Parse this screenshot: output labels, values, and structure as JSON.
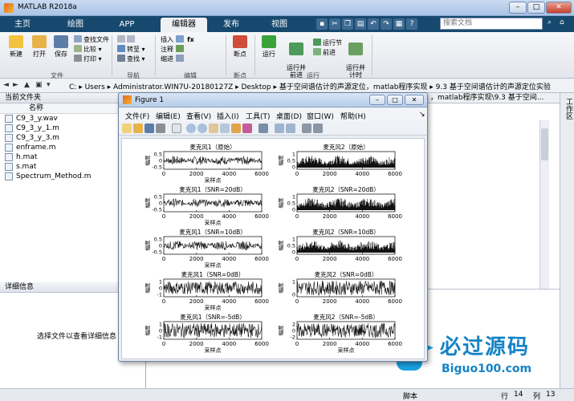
{
  "window": {
    "title": "MATLAB R2018a",
    "min": "–",
    "max": "□",
    "close": "✕"
  },
  "tabs": [
    {
      "label": "主页"
    },
    {
      "label": "绘图"
    },
    {
      "label": "APP"
    },
    {
      "label": "编辑器"
    },
    {
      "label": "发布"
    },
    {
      "label": "视图"
    }
  ],
  "search": {
    "placeholder": "搜索文档"
  },
  "ribbon": {
    "file_group": {
      "label": "文件",
      "new": "新建",
      "open": "打开",
      "save": "保存",
      "find_files": "查找文件",
      "compare": "比较",
      "print": "打印"
    },
    "nav_group": {
      "label": "导航",
      "goto": "转至",
      "find": "查找"
    },
    "edit_group": {
      "label": "编辑",
      "insert": "插入",
      "comment": "注释",
      "indent": "缩进",
      "fx": "fx"
    },
    "bp_group": {
      "label": "断点",
      "breakpoints": "断点"
    },
    "run_group": {
      "label": "运行",
      "run": "运行",
      "run_advance": "运行并\n前进",
      "run_section": "运行节",
      "advance": "前进",
      "run_time": "运行并\n计时"
    }
  },
  "address": {
    "path": [
      "C:",
      "Users",
      "Administrator.WIN7U-20180127Z",
      "Desktop",
      "基于空间谱估计的声源定位，matlab程序实现",
      "9.3 基于空间谱估计的声源定位实验"
    ]
  },
  "left": {
    "current_folder": "当前文件夹",
    "col_name": "名称",
    "files": [
      "C9_3_y.wav",
      "C9_3_y_1.m",
      "C9_3_y_3.m",
      "enframe.m",
      "h.mat",
      "s.mat",
      "Spectrum_Method.m"
    ],
    "details_title": "详细信息",
    "details_msg": "选择文件以查看详细信息"
  },
  "editor_tab": "，matlab程序实现\\9.3 基于空间...",
  "status": {
    "script": "脚本",
    "row_label": "行",
    "row": "14",
    "col_label": "列",
    "col": "13"
  },
  "right_tab": "工作区",
  "watermark": {
    "cn": "必过源码",
    "en": "Biguo100.com"
  },
  "figure": {
    "title": "Figure 1",
    "menu": [
      "文件(F)",
      "编辑(E)",
      "查看(V)",
      "插入(I)",
      "工具(T)",
      "桌面(D)",
      "窗口(W)",
      "帮助(H)"
    ],
    "colors": {
      "line": "#111111",
      "axis": "#000000"
    }
  },
  "chart_data": [
    {
      "type": "line",
      "title": "麦克风1（原始）",
      "xlabel": "采样点",
      "ylabel": "幅度",
      "xlim": [
        0,
        6000
      ],
      "xticks": [
        0,
        2000,
        4000,
        6000
      ],
      "yticks": [
        0.5,
        0,
        -0.5
      ],
      "amp": 0.55,
      "envelope": "bursty"
    },
    {
      "type": "line",
      "title": "麦克风2（原始）",
      "xlabel": "",
      "ylabel": "幅度",
      "xlim": [
        0,
        6000
      ],
      "xticks": [
        0,
        2000,
        4000,
        6000
      ],
      "yticks": [
        1,
        0.5,
        0
      ],
      "amp": 0.9,
      "envelope": "positive"
    },
    {
      "type": "line",
      "title": "麦克风1（SNR=20dB）",
      "xlabel": "采样点",
      "ylabel": "幅度",
      "xlim": [
        0,
        6000
      ],
      "xticks": [
        0,
        2000,
        4000,
        6000
      ],
      "yticks": [
        0.5,
        0,
        -0.5
      ],
      "amp": 0.55,
      "envelope": "bursty"
    },
    {
      "type": "line",
      "title": "麦克风2（SNR=20dB）",
      "xlabel": "",
      "ylabel": "幅度",
      "xlim": [
        0,
        6000
      ],
      "xticks": [
        0,
        2000,
        4000,
        6000
      ],
      "yticks": [
        1,
        0.5,
        0
      ],
      "amp": 0.9,
      "envelope": "positive"
    },
    {
      "type": "line",
      "title": "麦克风1（SNR=10dB）",
      "xlabel": "采样点",
      "ylabel": "幅度",
      "xlim": [
        0,
        6000
      ],
      "xticks": [
        0,
        2000,
        4000,
        6000
      ],
      "yticks": [
        0.5,
        0,
        -0.5
      ],
      "amp": 0.6,
      "envelope": "bursty"
    },
    {
      "type": "line",
      "title": "麦克风2（SNR=10dB）",
      "xlabel": "",
      "ylabel": "幅度",
      "xlim": [
        0,
        6000
      ],
      "xticks": [
        0,
        2000,
        4000,
        6000
      ],
      "yticks": [
        1,
        0.5,
        0
      ],
      "amp": 0.9,
      "envelope": "positive"
    },
    {
      "type": "line",
      "title": "麦克风1（SNR=0dB）",
      "xlabel": "采样点",
      "ylabel": "幅度",
      "xlim": [
        0,
        6000
      ],
      "xticks": [
        0,
        2000,
        4000,
        6000
      ],
      "yticks": [
        1,
        0,
        -1
      ],
      "amp": 0.8,
      "envelope": "noise"
    },
    {
      "type": "line",
      "title": "麦克风2（SNR=0dB）",
      "xlabel": "",
      "ylabel": "幅度",
      "xlim": [
        0,
        6000
      ],
      "xticks": [
        0,
        2000,
        4000,
        6000
      ],
      "yticks": [
        1,
        0
      ],
      "amp": 0.9,
      "envelope": "noise"
    },
    {
      "type": "line",
      "title": "麦克风1（SNR=-5dB）",
      "xlabel": "采样点",
      "ylabel": "幅度",
      "xlim": [
        0,
        6000
      ],
      "xticks": [
        0,
        2000,
        4000,
        6000
      ],
      "yticks": [
        1,
        0,
        -1
      ],
      "amp": 0.9,
      "envelope": "noise"
    },
    {
      "type": "line",
      "title": "麦克风2（SNR=-5dB）",
      "xlabel": "采样点",
      "ylabel": "幅度",
      "xlim": [
        0,
        6000
      ],
      "xticks": [
        0,
        2000,
        4000,
        6000
      ],
      "yticks": [
        2,
        0,
        -2
      ],
      "amp": 0.9,
      "envelope": "noise"
    }
  ]
}
